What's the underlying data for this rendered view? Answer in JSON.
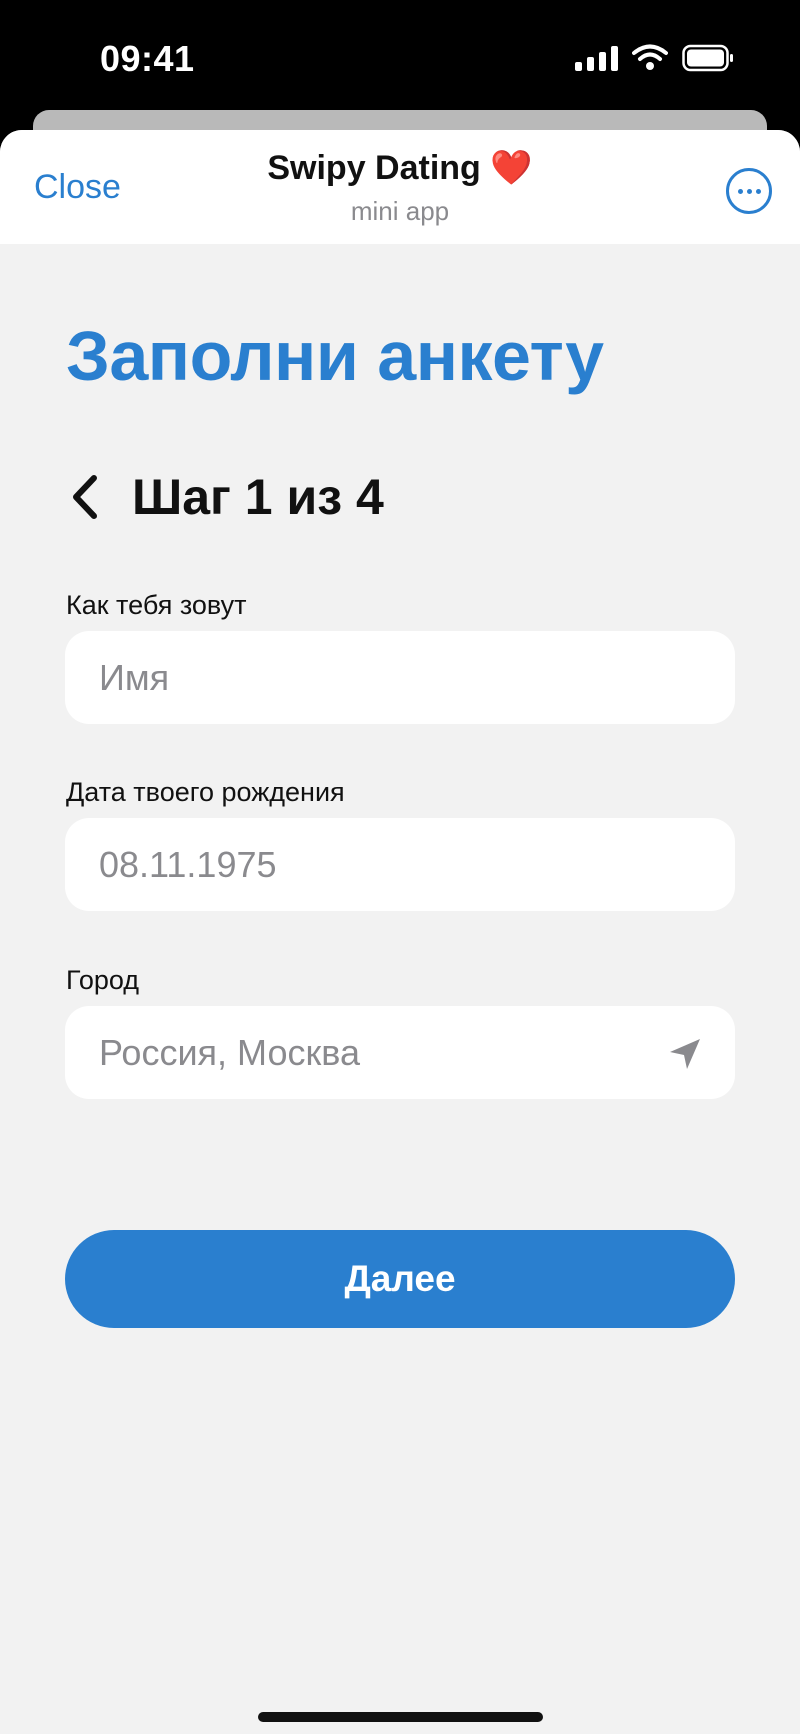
{
  "status_bar": {
    "time": "09:41"
  },
  "header": {
    "close_label": "Close",
    "title": "Swipy Dating",
    "title_emoji": "❤️",
    "subtitle": "mini app"
  },
  "form": {
    "page_title": "Заполни анкету",
    "step_text": "Шаг 1 из 4",
    "name": {
      "label": "Как тебя зовут",
      "placeholder": "Имя",
      "value": ""
    },
    "birthdate": {
      "label": "Дата твоего рождения",
      "placeholder": "08.11.1975",
      "value": ""
    },
    "city": {
      "label": "Город",
      "placeholder": "Россия, Москва",
      "value": ""
    },
    "next_label": "Далее"
  },
  "colors": {
    "accent": "#2a7fcf",
    "background": "#f2f2f2",
    "placeholder": "#8a8a8e"
  }
}
